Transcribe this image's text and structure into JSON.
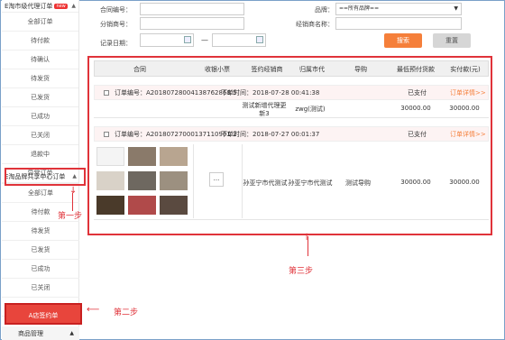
{
  "sidebar": {
    "group1_title": "E淘市级代理订单",
    "new_badge": "new",
    "group1_items": [
      "全部订单",
      "待付款",
      "待确认",
      "待发货",
      "已发货",
      "已成功",
      "已关闭",
      "退款中",
      "异常订单"
    ],
    "group2_title": "E淘品牌共享中心订单",
    "group2_items": [
      "全部订单",
      "待付款",
      "待发货",
      "已发货",
      "已成功",
      "已关闭",
      "退款中"
    ],
    "active_item": "A店签约单",
    "bottom_label": "商品管理"
  },
  "callouts": {
    "step1": "第一步",
    "step2": "第二步",
    "step3": "第三步"
  },
  "filters": {
    "order_no_label": "合同编号：",
    "brand_label": "品牌：",
    "brand_value": "==所有品牌==",
    "distributor_no_label": "分销商号：",
    "distributor_name_label": "经销商名称：",
    "date_label": "记录日期：",
    "date_sep": "—",
    "search_button": "搜索",
    "reset_button": "重置"
  },
  "table": {
    "headers": [
      "合同",
      "收银小票",
      "签约经销商",
      "归属市代",
      "导购",
      "最低预付货款",
      "实付款(元)"
    ],
    "orders": [
      {
        "order_no": "订单编号：A20180728004138762868 5",
        "time": "下单时间：2018-07-28 00:41:38",
        "status": "已支付",
        "detail": "订单详情>>",
        "dealer": "测试新增代理更新3",
        "city_agent": "zwg(测试)",
        "guide": "",
        "min_pay": "30000.00",
        "paid": "30000.00"
      },
      {
        "order_no": "订单编号：A20180727000137110901 2",
        "time": "下单时间：2018-07-27 00:01:37",
        "status": "已支付",
        "detail": "订单详情>>",
        "receipt": "...",
        "dealer": "孙亚宁市代测试",
        "city_agent": "孙亚宁市代测试",
        "guide": "测试导购",
        "min_pay": "30000.00",
        "paid": "30000.00"
      }
    ]
  },
  "colors": {
    "accent": "#f57f3a",
    "annotation": "#e0333a",
    "active": "#e8453c"
  }
}
